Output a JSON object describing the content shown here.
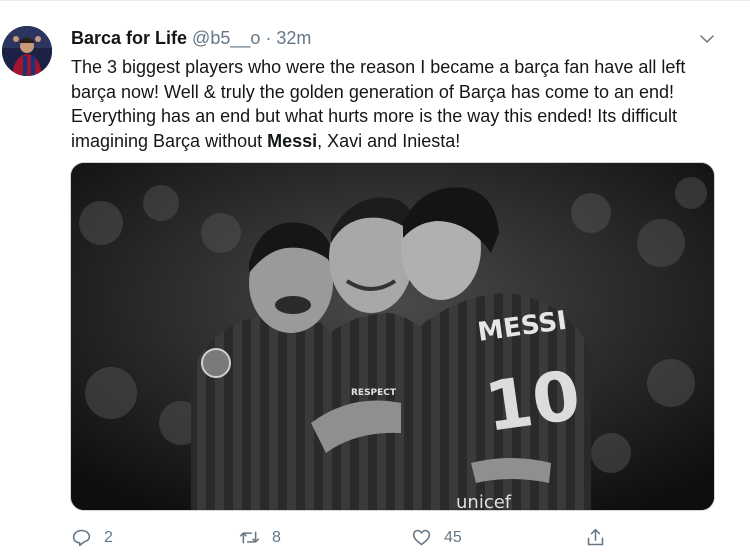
{
  "tweet": {
    "author_name": "Barca for Life",
    "handle": "@b5__o",
    "separator": "·",
    "time": "32m",
    "text_part1": "The 3 biggest players who were the reason I became a barça fan have all left barça now! Well & truly the golden generation of Barça has come to an end! Everything has an end but what hurts more is the way this ended! Its difficult imagining Barça without ",
    "text_bold": "Messi",
    "text_part2": ", Xavi and Iniesta!",
    "jersey_name": "MESSI",
    "jersey_number": "10",
    "sponsor_text": "unicef",
    "badge_text": "RESPECT",
    "actions": {
      "reply_count": "2",
      "retweet_count": "8",
      "like_count": "45"
    }
  },
  "icons": {
    "caret": "chevron-down-icon",
    "reply": "reply-icon",
    "retweet": "retweet-icon",
    "like": "heart-icon",
    "share": "share-icon"
  },
  "colors": {
    "text": "#14171a",
    "secondary": "#657786",
    "border": "#e6ecf0"
  }
}
